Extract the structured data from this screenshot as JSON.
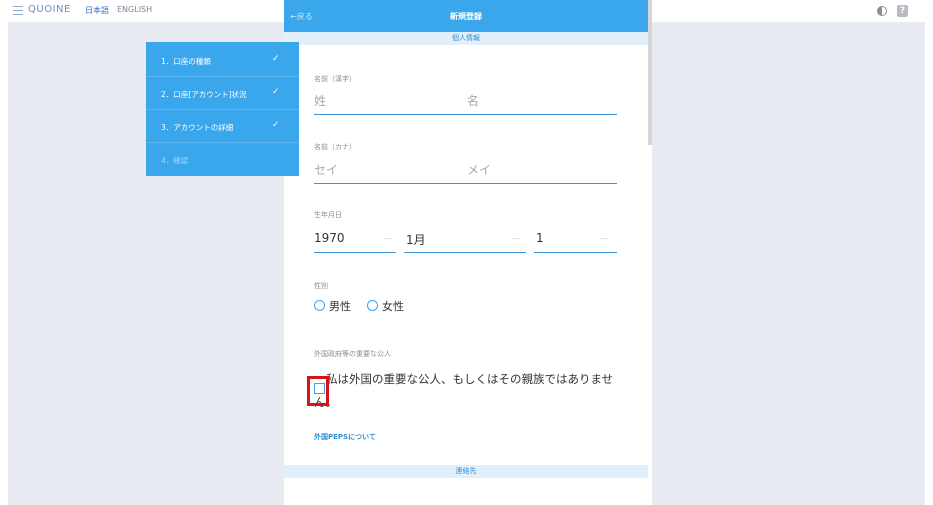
{
  "topbar": {
    "brand": "QUOINE",
    "lang_ja": "日本語",
    "lang_en": "ENGLISH",
    "help_glyph": "?"
  },
  "modal": {
    "back_label": "←戻る",
    "title": "新規登録",
    "section_personal": "個人情報",
    "section_contact": "連絡先"
  },
  "form": {
    "name_kanji": {
      "label": "名前（漢字）",
      "last_placeholder": "姓",
      "first_placeholder": "名"
    },
    "name_kana": {
      "label": "名前（カナ）",
      "last_placeholder": "セイ",
      "first_placeholder": "メイ"
    },
    "birthdate": {
      "label": "生年月日",
      "year": "1970",
      "month": "1月",
      "day": "1",
      "separator": "---"
    },
    "gender": {
      "label": "性別",
      "male": "男性",
      "female": "女性"
    },
    "pep": {
      "label": "外国政府等の重要な公人",
      "statement": "私は外国の重要な公人、もしくはその親族ではありません。",
      "link": "外国PEPSについて"
    }
  },
  "steps": {
    "items": [
      {
        "label": "1．口座の種類",
        "check": "✓"
      },
      {
        "label": "2．口座[アカウント]状況",
        "check": "✓"
      },
      {
        "label": "3．アカウントの詳細",
        "check": "✓"
      },
      {
        "label": "4．確認",
        "check": ""
      }
    ]
  },
  "colors": {
    "accent": "#3aa7ed",
    "background_panel": "#e8ecf2",
    "highlight": "#d4141a"
  }
}
